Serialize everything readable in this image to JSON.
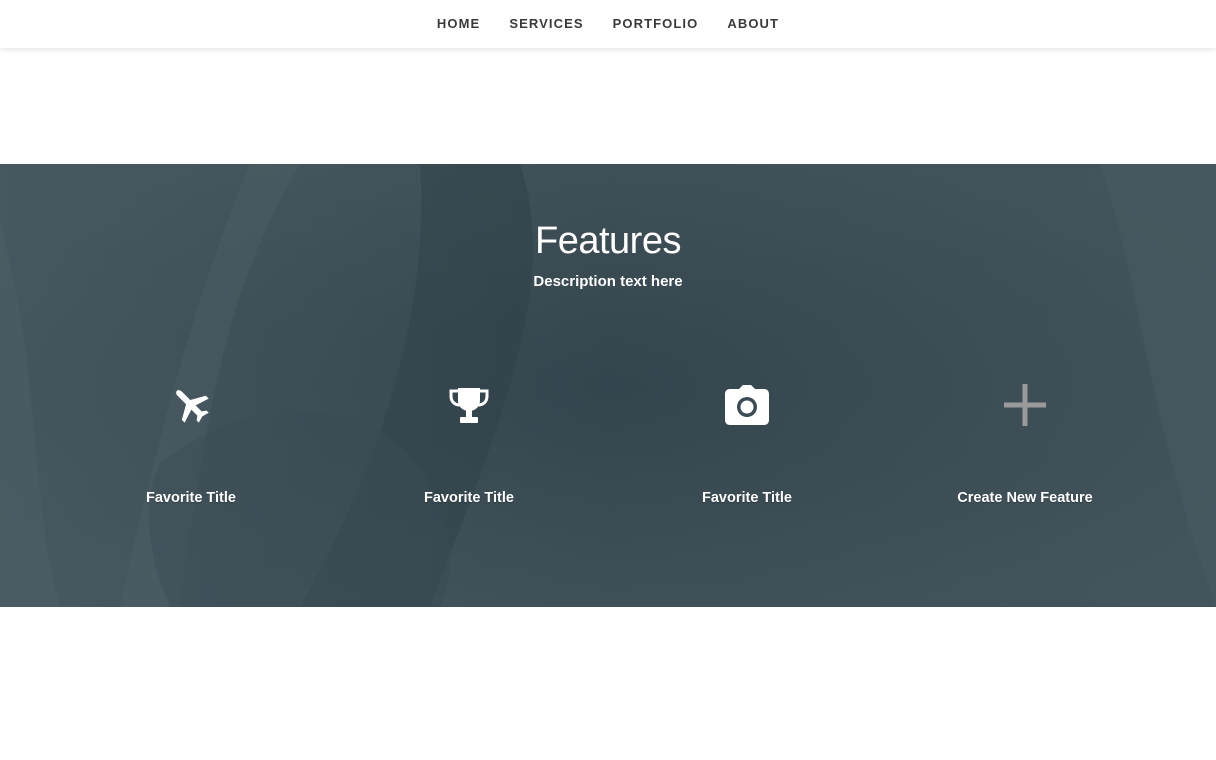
{
  "nav": {
    "items": [
      {
        "label": "HOME"
      },
      {
        "label": "SERVICES"
      },
      {
        "label": "PORTFOLIO"
      },
      {
        "label": "ABOUT"
      }
    ]
  },
  "features": {
    "title": "Features",
    "description": "Description text here",
    "items": [
      {
        "title": "Favorite Title",
        "icon": "airplane-icon"
      },
      {
        "title": "Favorite Title",
        "icon": "trophy-icon"
      },
      {
        "title": "Favorite Title",
        "icon": "camera-icon"
      },
      {
        "title": "Create New Feature",
        "icon": "plus-icon"
      }
    ]
  },
  "colors": {
    "nav_text": "#3a3a3a",
    "section_bg": "#3e4f58",
    "text_light": "#ffffff",
    "plus_icon": "#9a9a9a"
  }
}
